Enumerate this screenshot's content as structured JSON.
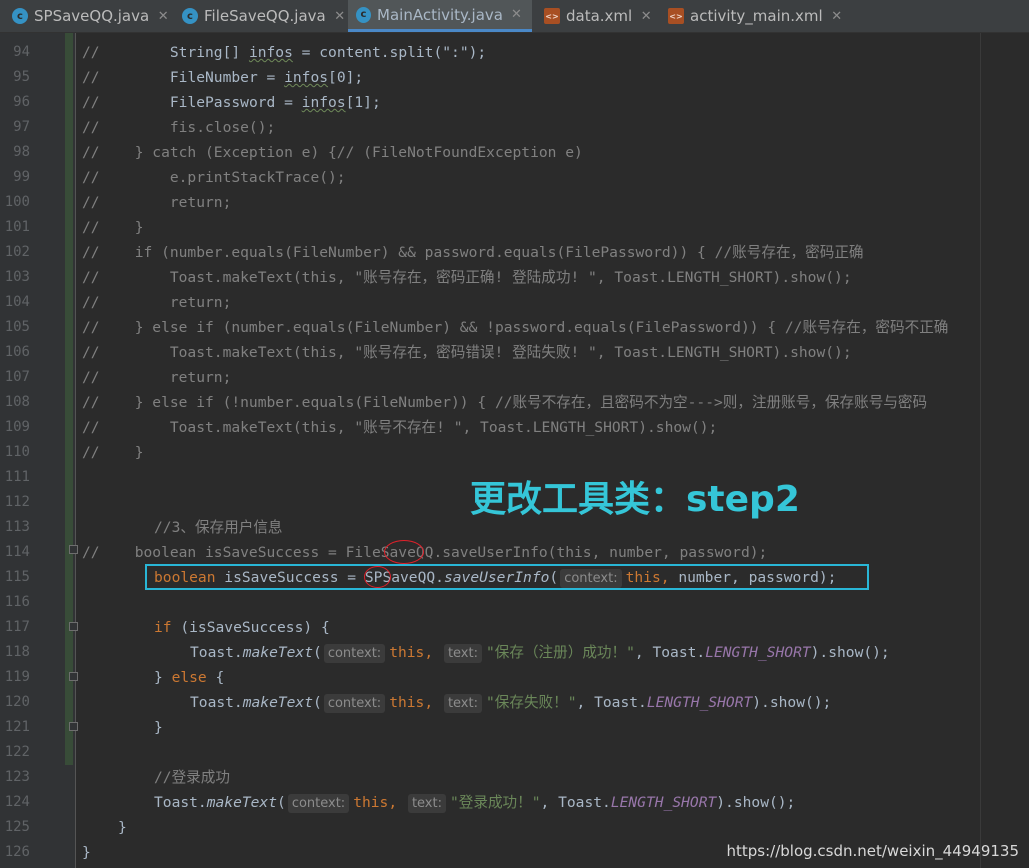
{
  "tabs": [
    {
      "label": "SPSaveQQ.java",
      "icon": "java-class-icon"
    },
    {
      "label": "FileSaveQQ.java",
      "icon": "java-class-icon"
    },
    {
      "label": "MainActivity.java",
      "icon": "java-class-icon",
      "active": true
    },
    {
      "label": "data.xml",
      "icon": "xml-file-icon"
    },
    {
      "label": "activity_main.xml",
      "icon": "xml-file-icon"
    }
  ],
  "line_numbers": [
    "94",
    "95",
    "96",
    "97",
    "98",
    "99",
    "100",
    "101",
    "102",
    "103",
    "104",
    "105",
    "106",
    "107",
    "108",
    "109",
    "110",
    "111",
    "112",
    "113",
    "114",
    "115",
    "116",
    "117",
    "118",
    "119",
    "120",
    "121",
    "122",
    "123",
    "124",
    "125",
    "126"
  ],
  "annotation": "更改工具类：step2",
  "watermark": "https://blog.csdn.net/weixin_44949135",
  "code": {
    "l94": [
      "//",
      "        String[] ",
      "infos",
      " = content.split(\":\");"
    ],
    "l95": [
      "//",
      "        FileNumber = ",
      "infos",
      "[0];"
    ],
    "l96": [
      "//",
      "        FilePassword = ",
      "infos",
      "[1];"
    ],
    "l97": "//        fis.close();",
    "l98": "//    } catch (Exception e) {// (FileNotFoundException e)",
    "l99": "//        e.printStackTrace();",
    "l100": "//        return;",
    "l101": "//    }",
    "l102": "//    if (number.equals(FileNumber) && password.equals(FilePassword)) { //账号存在，密码正确",
    "l103": "//        Toast.makeText(this, \"账号存在，密码正确! 登陆成功! \", Toast.LENGTH_SHORT).show();",
    "l104": "//        return;",
    "l105": "//    } else if (number.equals(FileNumber) && !password.equals(FilePassword)) { //账号存在，密码不正确",
    "l106": "//        Toast.makeText(this, \"账号存在，密码错误! 登陆失败! \", Toast.LENGTH_SHORT).show();",
    "l107": "//        return;",
    "l108": "//    } else if (!number.equals(FileNumber)) { //账号不存在，且密码不为空--->则，注册账号，保存账号与密码",
    "l109": "//        Toast.makeText(this, \"账号不存在! \", Toast.LENGTH_SHORT).show();",
    "l110": "//    }",
    "l113": "//3、保存用户信息",
    "l114": "//    boolean isSaveSuccess = FileSaveQQ.saveUserInfo(this, number, password);",
    "l115": {
      "kw": "boolean",
      "rest": " isSaveSuccess = SPSaveQQ.",
      "method": "saveUserInfo",
      "paren": "(",
      "hint": "context:",
      "this": "this,",
      "tail": " number, password);"
    },
    "l117": {
      "kw": "if",
      "rest": " (isSaveSuccess) {"
    },
    "l118": {
      "pre": "Toast.",
      "method": "makeText",
      "paren": "(",
      "hint1": "context:",
      "this": "this,",
      "hint2": "text:",
      "str": "\"保存（注册）成功！\"",
      "mid": ", Toast.",
      "const": "LENGTH_SHORT",
      "tail": ").show();"
    },
    "l119": {
      "a": "} ",
      "kw": "else",
      "b": " {"
    },
    "l120": {
      "pre": "Toast.",
      "method": "makeText",
      "paren": "(",
      "hint1": "context:",
      "this": "this,",
      "hint2": "text:",
      "str": "\"保存失败！\"",
      "mid": ", Toast.",
      "const": "LENGTH_SHORT",
      "tail": ").show();"
    },
    "l121": "}",
    "l123": "//登录成功",
    "l124": {
      "pre": "Toast.",
      "method": "makeText",
      "paren": "(",
      "hint1": "context:",
      "this": "this,",
      "hint2": "text:",
      "str": "\"登录成功！\"",
      "mid": ", Toast.",
      "const": "LENGTH_SHORT",
      "tail": ").show();"
    },
    "l125": "}",
    "l126": "}"
  }
}
